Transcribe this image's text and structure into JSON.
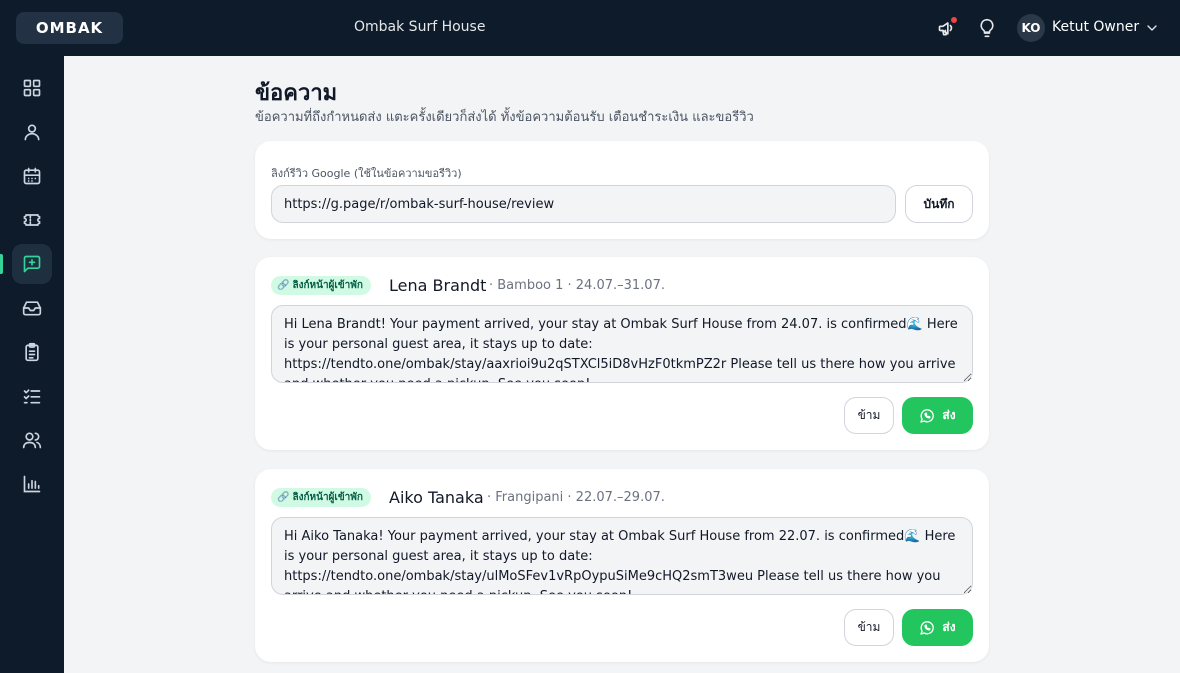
{
  "topbar": {
    "logo": "OMBAK",
    "property_name": "Ombak Surf House",
    "user_initials": "KO",
    "user_name": "Ketut Owner"
  },
  "sidebar": {
    "items": [
      {
        "icon": "dashboard-grid-icon",
        "active": false
      },
      {
        "icon": "user-icon",
        "active": false
      },
      {
        "icon": "calendar-icon",
        "active": false
      },
      {
        "icon": "ticket-icon",
        "active": false
      },
      {
        "icon": "message-plus-icon",
        "active": true
      },
      {
        "icon": "inbox-icon",
        "active": false
      },
      {
        "icon": "clipboard-icon",
        "active": false
      },
      {
        "icon": "checklist-icon",
        "active": false
      },
      {
        "icon": "users-icon",
        "active": false
      },
      {
        "icon": "bar-chart-icon",
        "active": false
      }
    ]
  },
  "page": {
    "title": "ข้อความ",
    "subtitle": "ข้อความที่ถึงกำหนดส่ง แตะครั้งเดียวก็ส่งได้ ทั้งข้อความต้อนรับ เตือนชำระเงิน และขอรีวิว"
  },
  "review_link": {
    "label": "ลิงก์รีวิว Google (ใช้ในข้อความขอรีวิว)",
    "value": "https://g.page/r/ombak-surf-house/review",
    "save_label": "บันทึก"
  },
  "messages": [
    {
      "badge": "ลิงก์หน้าผู้เข้าพัก",
      "guest_name": "Lena Brandt",
      "meta": "· Bamboo 1 · 24.07.–31.07.",
      "text": "Hi Lena Brandt! Your payment arrived, your stay at Ombak Surf House from 24.07. is confirmed🌊 Here is your personal guest area, it stays up to date: https://tendto.one/ombak/stay/aaxrioi9u2qSTXCl5iD8vHzF0tkmPZ2r Please tell us there how you arrive and whether you need a pickup. See you soon!",
      "skip_label": "ข้าม",
      "send_label": "ส่ง"
    },
    {
      "badge": "ลิงก์หน้าผู้เข้าพัก",
      "guest_name": "Aiko Tanaka",
      "meta": "· Frangipani · 22.07.–29.07.",
      "text": "Hi Aiko Tanaka! Your payment arrived, your stay at Ombak Surf House from 22.07. is confirmed🌊 Here is your personal guest area, it stays up to date: https://tendto.one/ombak/stay/ulMoSFev1vRpOypuSiMe9cHQ2smT3weu Please tell us there how you arrive and whether you need a pickup. See you soon!",
      "skip_label": "ข้าม",
      "send_label": "ส่ง"
    }
  ]
}
